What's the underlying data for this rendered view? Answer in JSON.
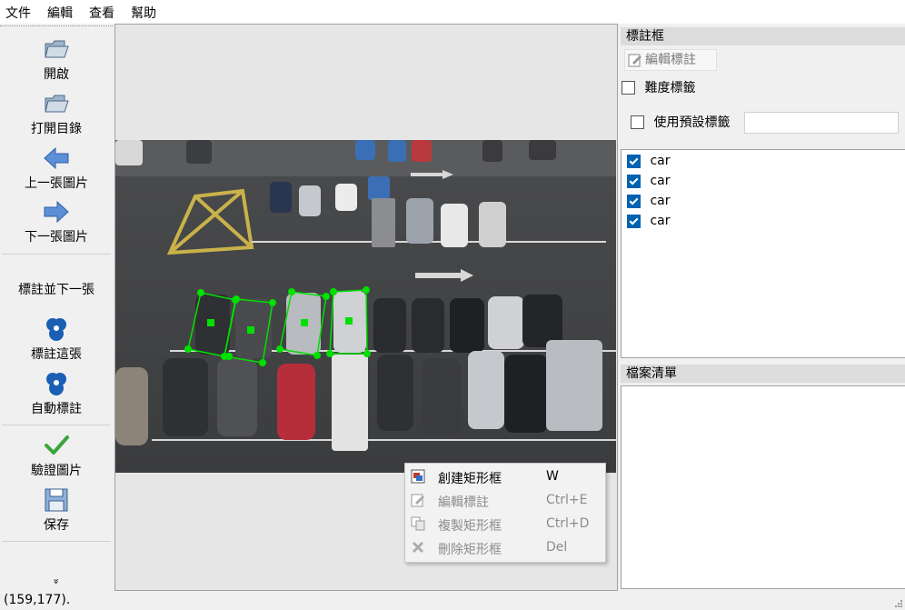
{
  "menu": [
    "文件",
    "編輯",
    "查看",
    "幫助"
  ],
  "toolbar": {
    "open": "開啟",
    "open_dir": "打開目錄",
    "prev": "上一張圖片",
    "next": "下一張圖片",
    "annotate_next": "標註並下一張",
    "annotate_this": "標註這張",
    "auto_annotate": "自動標註",
    "verify": "驗證圖片",
    "save": "保存",
    "more": "»"
  },
  "label_dock": {
    "title": "標註框",
    "edit_label_button": "編輯標註",
    "difficult_label": "難度標籤",
    "difficult_checked": false,
    "use_default_label": "使用預設標籤",
    "use_default_checked": false,
    "default_label_value": "",
    "labels": [
      {
        "text": "car",
        "checked": true
      },
      {
        "text": "car",
        "checked": true
      },
      {
        "text": "car",
        "checked": true
      },
      {
        "text": "car",
        "checked": true
      }
    ]
  },
  "file_dock": {
    "title": "檔案清單",
    "files": []
  },
  "context_menu": {
    "items": [
      {
        "label": "創建矩形框",
        "shortcut": "W",
        "enabled": true,
        "icon": "create-rect-icon"
      },
      {
        "label": "編輯標註",
        "shortcut": "Ctrl+E",
        "enabled": false,
        "icon": "edit-icon"
      },
      {
        "label": "複製矩形框",
        "shortcut": "Ctrl+D",
        "enabled": false,
        "icon": "copy-icon"
      },
      {
        "label": "刪除矩形框",
        "shortcut": "Del",
        "enabled": false,
        "icon": "delete-icon"
      }
    ]
  },
  "status": {
    "text": "(159,177)."
  },
  "colors": {
    "box": "#00e000",
    "check": "#0063b1"
  }
}
